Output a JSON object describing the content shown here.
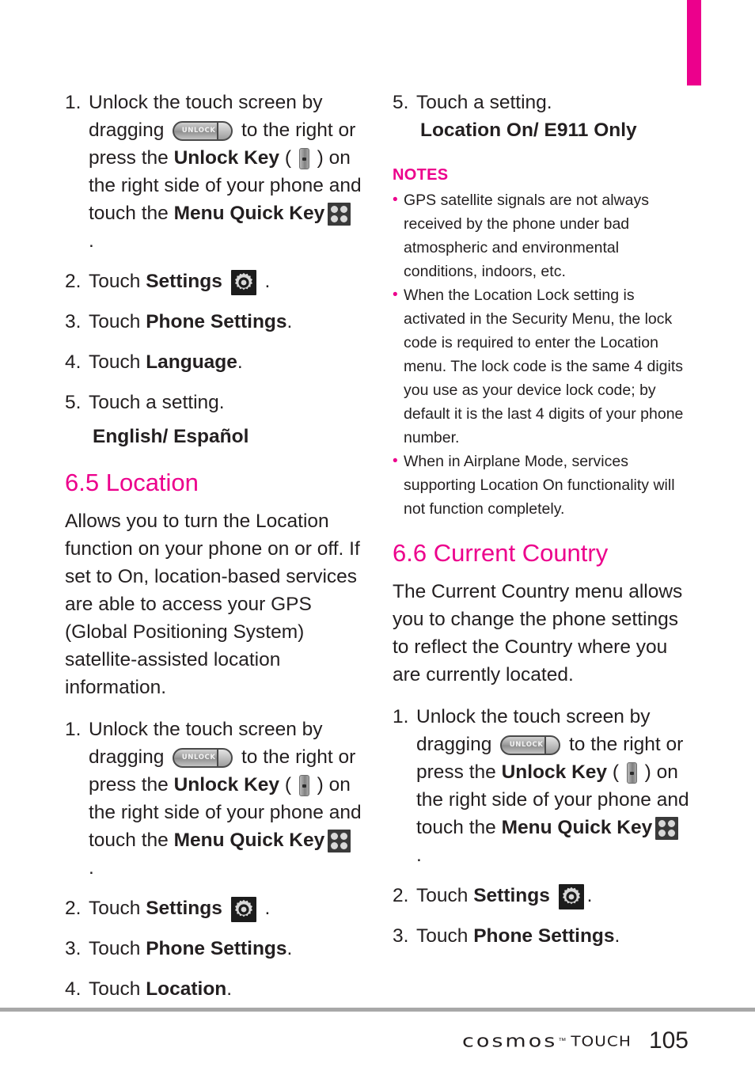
{
  "page": {
    "number": "105",
    "brand": "cosmos",
    "brand_tm": "™",
    "brand_sub": "TOUCH",
    "accent_color": "#ec008c",
    "text_color": "#231f20"
  },
  "icons": {
    "unlock_slider_label": "UNLOCK",
    "unlock_slider_name": "unlock-slider-icon",
    "side_key_name": "unlock-side-key-icon",
    "menu_quick_key_name": "menu-quick-key-icon",
    "settings_gear_name": "settings-gear-icon"
  },
  "left_column": {
    "list_1": [
      {
        "num": "1.",
        "part_a": "Unlock the touch screen by dragging ",
        "part_b": " to the right or press the ",
        "bold_1": "Unlock Key",
        "part_c": " ( ",
        "part_d": " ) on the right side of your phone and touch the ",
        "bold_2": "Menu Quick Key",
        "part_e": " ."
      },
      {
        "num": "2.",
        "pre": "Touch ",
        "bold": "Settings",
        "post": " ."
      },
      {
        "num": "3.",
        "pre": "Touch ",
        "bold": "Phone Settings",
        "post": "."
      },
      {
        "num": "4.",
        "pre": "Touch ",
        "bold": "Language",
        "post": "."
      },
      {
        "num": "5.",
        "pre": "Touch a setting.",
        "bold": "",
        "post": ""
      }
    ],
    "setting_options": "English/ Español",
    "section": {
      "heading": "6.5 Location",
      "body": "Allows you to turn the Location function on your phone on or off. If set to On, location-based services are able to access your GPS (Global Positioning System) satellite-assisted location information."
    },
    "list_2": [
      {
        "num": "1.",
        "part_a": "Unlock the touch screen by dragging ",
        "part_b": " to the right or press the ",
        "bold_1": "Unlock Key",
        "part_c": " ( ",
        "part_d": " ) on the right side of your phone and touch the ",
        "bold_2": "Menu Quick Key",
        "part_e": " ."
      },
      {
        "num": "2.",
        "pre": "Touch ",
        "bold": "Settings",
        "post": " ."
      },
      {
        "num": "3.",
        "pre": "Touch ",
        "bold": "Phone Settings",
        "post": "."
      },
      {
        "num": "4.",
        "pre": "Touch ",
        "bold": "Location",
        "post": "."
      }
    ]
  },
  "right_column": {
    "step_5": {
      "num": "5.",
      "text": "Touch a setting."
    },
    "setting_options": "Location On/ E911 Only",
    "notes": {
      "title": "NOTES",
      "bullet_char": "•",
      "items": [
        "GPS satellite signals are not always received by the phone under bad atmospheric and environmental conditions, indoors, etc.",
        "When the Location Lock setting is activated in the Security Menu, the lock code is required to enter the Location menu. The lock code is the same 4 digits you use as your device lock code; by default it is the last 4 digits of your phone number.",
        "When in Airplane Mode, services supporting Location On functionality will not function completely."
      ]
    },
    "section": {
      "heading": "6.6 Current Country",
      "body": "The Current Country menu allows you to change the phone settings to reflect the Country where you are currently located."
    },
    "list": [
      {
        "num": "1.",
        "part_a": "Unlock the touch screen by dragging ",
        "part_b": " to the right or press the ",
        "bold_1": "Unlock Key",
        "part_c": " ( ",
        "part_d": " ) on the right side of your phone and touch the ",
        "bold_2": "Menu Quick Key",
        "part_e": " ."
      },
      {
        "num": "2.",
        "pre": "Touch ",
        "bold": "Settings",
        "post": "."
      },
      {
        "num": "3.",
        "pre": "Touch ",
        "bold": "Phone Settings",
        "post": "."
      }
    ]
  }
}
